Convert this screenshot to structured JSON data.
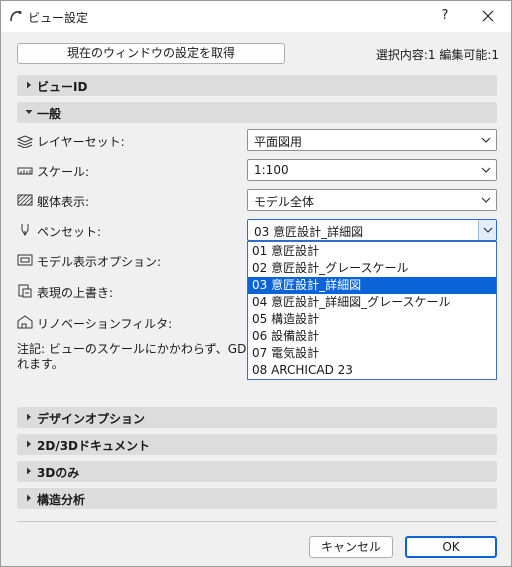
{
  "window": {
    "title": "ビュー設定",
    "help": "?"
  },
  "top": {
    "fetch_button": "現在のウィンドウの設定を取得",
    "selection_info": "選択内容:1 編集可能:1"
  },
  "sections": {
    "view_id": "ビューID",
    "general": "一般",
    "design_options": "デザインオプション",
    "doc_2d3d": "2D/3Dドキュメント",
    "only_3d": "3Dのみ",
    "structural": "構造分析"
  },
  "settings": {
    "layer_set": {
      "label": "レイヤーセット:",
      "value": "平面図用"
    },
    "scale": {
      "label": "スケール:",
      "value": "1:100"
    },
    "structure": {
      "label": "躯体表示:",
      "value": "モデル全体"
    },
    "pen_set": {
      "label": "ペンセット:",
      "value": "03 意匠設計_詳細図"
    },
    "model_view": {
      "label": "モデル表示オプション:"
    },
    "override": {
      "label": "表現の上書き:"
    },
    "renovation": {
      "label": "リノベーションフィルタ:"
    }
  },
  "note": {
    "line1": "注記: ビューのスケールにかかわらず、GDLオブジェ",
    "line2": "れます。"
  },
  "pen_set_options": [
    "01 意匠設計",
    "02 意匠設計_グレースケール",
    "03 意匠設計_詳細図",
    "04 意匠設計_詳細図_グレースケール",
    "05 構造設計",
    "06 設備設計",
    "07 電気設計",
    "08 ARCHICAD 23"
  ],
  "pen_set_selected_index": 2,
  "buttons": {
    "cancel": "キャンセル",
    "ok": "OK"
  },
  "colors": {
    "accent": "#0a64d8",
    "section_bg": "#dcdcdc",
    "dialog_bg": "#f0f0f0"
  }
}
